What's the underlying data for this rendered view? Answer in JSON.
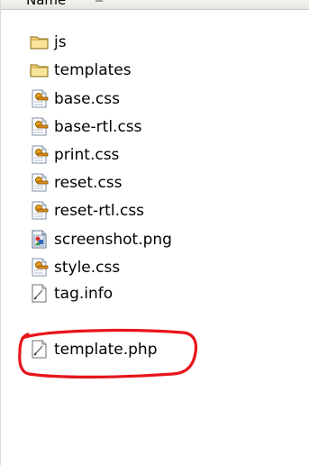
{
  "header": {
    "column_title": "Name"
  },
  "files": [
    {
      "name": "js",
      "icon": "folder-icon"
    },
    {
      "name": "templates",
      "icon": "folder-icon"
    },
    {
      "name": "base.css",
      "icon": "css-file-icon"
    },
    {
      "name": "base-rtl.css",
      "icon": "css-file-icon"
    },
    {
      "name": "print.css",
      "icon": "css-file-icon"
    },
    {
      "name": "reset.css",
      "icon": "css-file-icon"
    },
    {
      "name": "reset-rtl.css",
      "icon": "css-file-icon"
    },
    {
      "name": "screenshot.png",
      "icon": "image-file-icon"
    },
    {
      "name": "style.css",
      "icon": "css-file-icon"
    },
    {
      "name": "tag.info",
      "icon": "generic-file-icon"
    },
    {
      "name": "template.php",
      "icon": "php-file-icon"
    }
  ],
  "annotation": {
    "color": "#e8141c",
    "target": "template.php"
  }
}
